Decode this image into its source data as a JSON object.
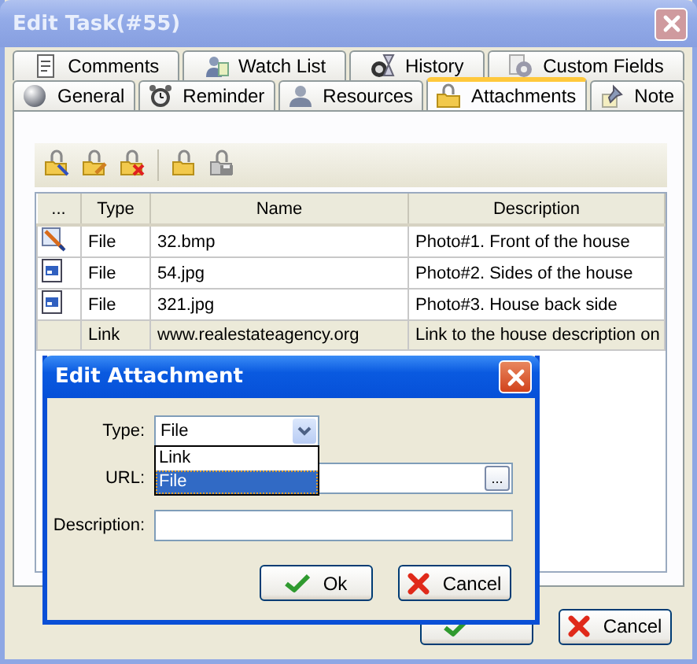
{
  "window": {
    "title": "Edit Task(#55)"
  },
  "tab_rows": [
    {
      "tabs": [
        {
          "label": "Comments",
          "kind": "document",
          "selected": false
        },
        {
          "label": "Watch List",
          "kind": "people",
          "selected": false
        },
        {
          "label": "History",
          "kind": "hourglass",
          "selected": false
        },
        {
          "label": "Custom Fields",
          "kind": "gear",
          "selected": false
        }
      ]
    },
    {
      "tabs": [
        {
          "label": "General",
          "kind": "sphere",
          "selected": false
        },
        {
          "label": "Reminder",
          "kind": "alarm",
          "selected": false
        },
        {
          "label": "Resources",
          "kind": "person",
          "selected": false
        },
        {
          "label": "Attachments",
          "kind": "lockfolder",
          "selected": true
        },
        {
          "label": "Note",
          "kind": "pin",
          "selected": false
        }
      ]
    }
  ],
  "toolbar": [
    {
      "kind": "add",
      "disabled": false
    },
    {
      "kind": "edit",
      "disabled": false
    },
    {
      "kind": "delete",
      "disabled": false
    },
    {
      "kind": "open",
      "disabled": false
    },
    {
      "kind": "save",
      "disabled": true
    }
  ],
  "table": {
    "columns": [
      "...",
      "Type",
      "Name",
      "Description"
    ],
    "rows": [
      {
        "kind": "paint",
        "type": "File",
        "name": "32.bmp",
        "description": "Photo#1. Front of the house",
        "selected": false
      },
      {
        "kind": "image",
        "type": "File",
        "name": "54.jpg",
        "description": "Photo#2. Sides of the house",
        "selected": false
      },
      {
        "kind": "image",
        "type": "File",
        "name": "321.jpg",
        "description": "Photo#3. House back side",
        "selected": false
      },
      {
        "kind": "none",
        "type": "Link",
        "name": "www.realestateagency.org",
        "description": "Link to the house description on",
        "selected": true
      }
    ]
  },
  "buttons": [
    {
      "kind": "ok"
    },
    {
      "kind": "cancel",
      "label": "Cancel"
    }
  ],
  "dialog": {
    "title": "Edit Attachment",
    "fields": [
      {
        "kind": "combo",
        "label": "Type:",
        "value": "File"
      },
      {
        "kind": "browse",
        "label": "URL:",
        "button": "..."
      },
      {
        "kind": "text",
        "label": "Description:"
      }
    ],
    "dropdown": [
      {
        "label": "Link",
        "selected": false
      },
      {
        "label": "File",
        "selected": true
      }
    ],
    "buttons": [
      {
        "kind": "ok",
        "label": "Ok"
      },
      {
        "kind": "cancel",
        "label": "Cancel"
      }
    ]
  }
}
